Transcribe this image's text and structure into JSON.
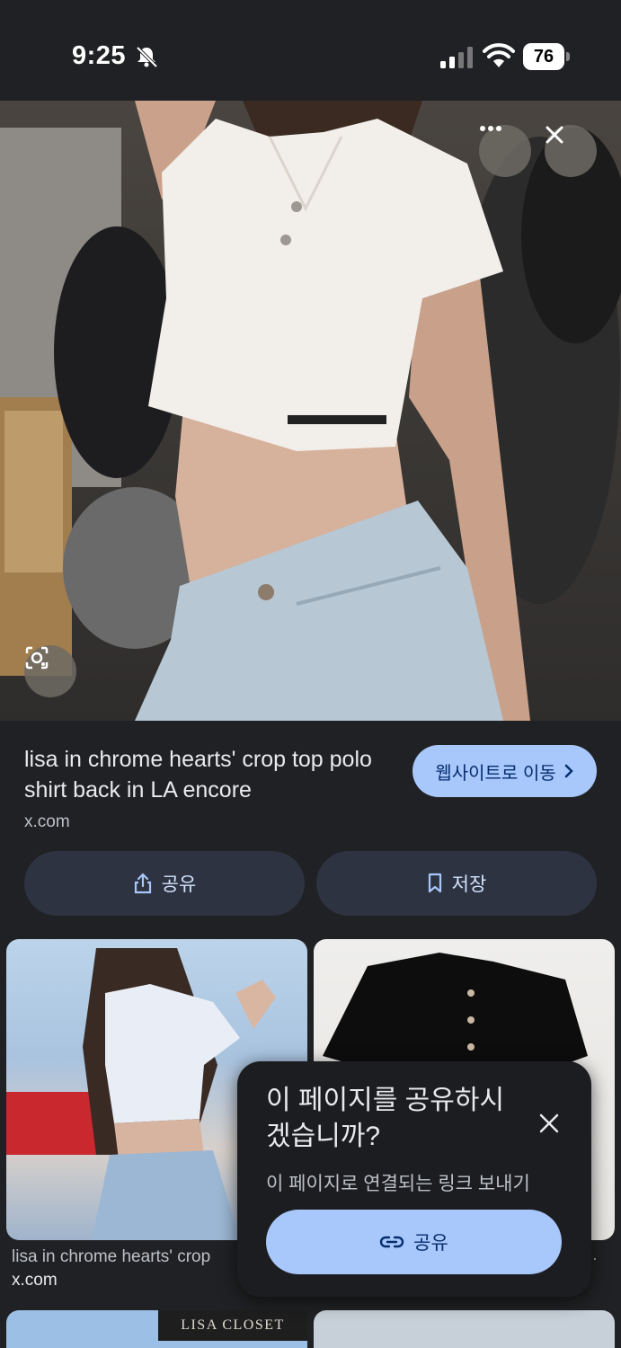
{
  "status_bar": {
    "time": "9:25",
    "battery": "76"
  },
  "viewer": {
    "more_label": "···",
    "title": "lisa in chrome hearts' crop top polo shirt back in LA encore",
    "source": "x.com",
    "visit_label": "웹사이트로 이동",
    "share_label": "공유",
    "save_label": "저장"
  },
  "related": {
    "item1_title": "lisa in chrome hearts' crop",
    "item1_source": "x.com",
    "item2_dots": "..",
    "banner_text": "LISA CLOSET"
  },
  "share_dialog": {
    "title": "이 페이지를 공유하시겠습니까?",
    "description": "이 페이지로 연결되는 링크 보내기",
    "share_label": "공유"
  },
  "colors": {
    "background": "#202124",
    "accent": "#a8c7fa",
    "button_dark": "#2d3340"
  }
}
